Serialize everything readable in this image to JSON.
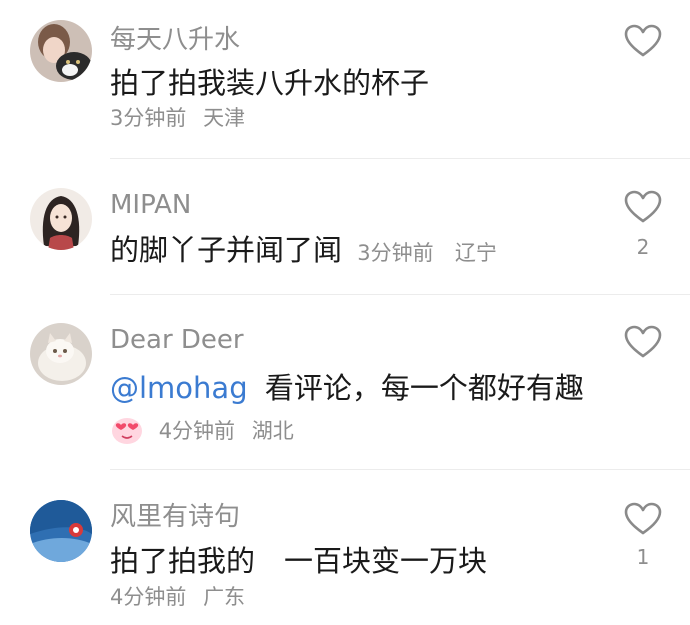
{
  "comments": [
    {
      "username": "每天八升水",
      "text": "拍了拍我装八升水的杯子",
      "time": "3分钟前",
      "location": "天津",
      "likes": "",
      "avatar_icon": "cat-photo-avatar"
    },
    {
      "username": "MIPAN",
      "text": "的脚丫子并闻了闻",
      "time": "3分钟前",
      "location": "辽宁",
      "likes": "2",
      "avatar_icon": "anime-character-avatar"
    },
    {
      "username": "Dear Deer",
      "mention": "@lmohag",
      "text": "看评论，每一个都好有趣",
      "time": "4分钟前",
      "location": "湖北",
      "likes": "",
      "avatar_icon": "white-cat-avatar",
      "badge_icon": "heart-eyes-emoji-icon"
    },
    {
      "username": "风里有诗句",
      "text": "拍了拍我的　一百块变一万块",
      "time": "4分钟前",
      "location": "广东",
      "likes": "1",
      "avatar_icon": "blue-robot-avatar"
    }
  ]
}
